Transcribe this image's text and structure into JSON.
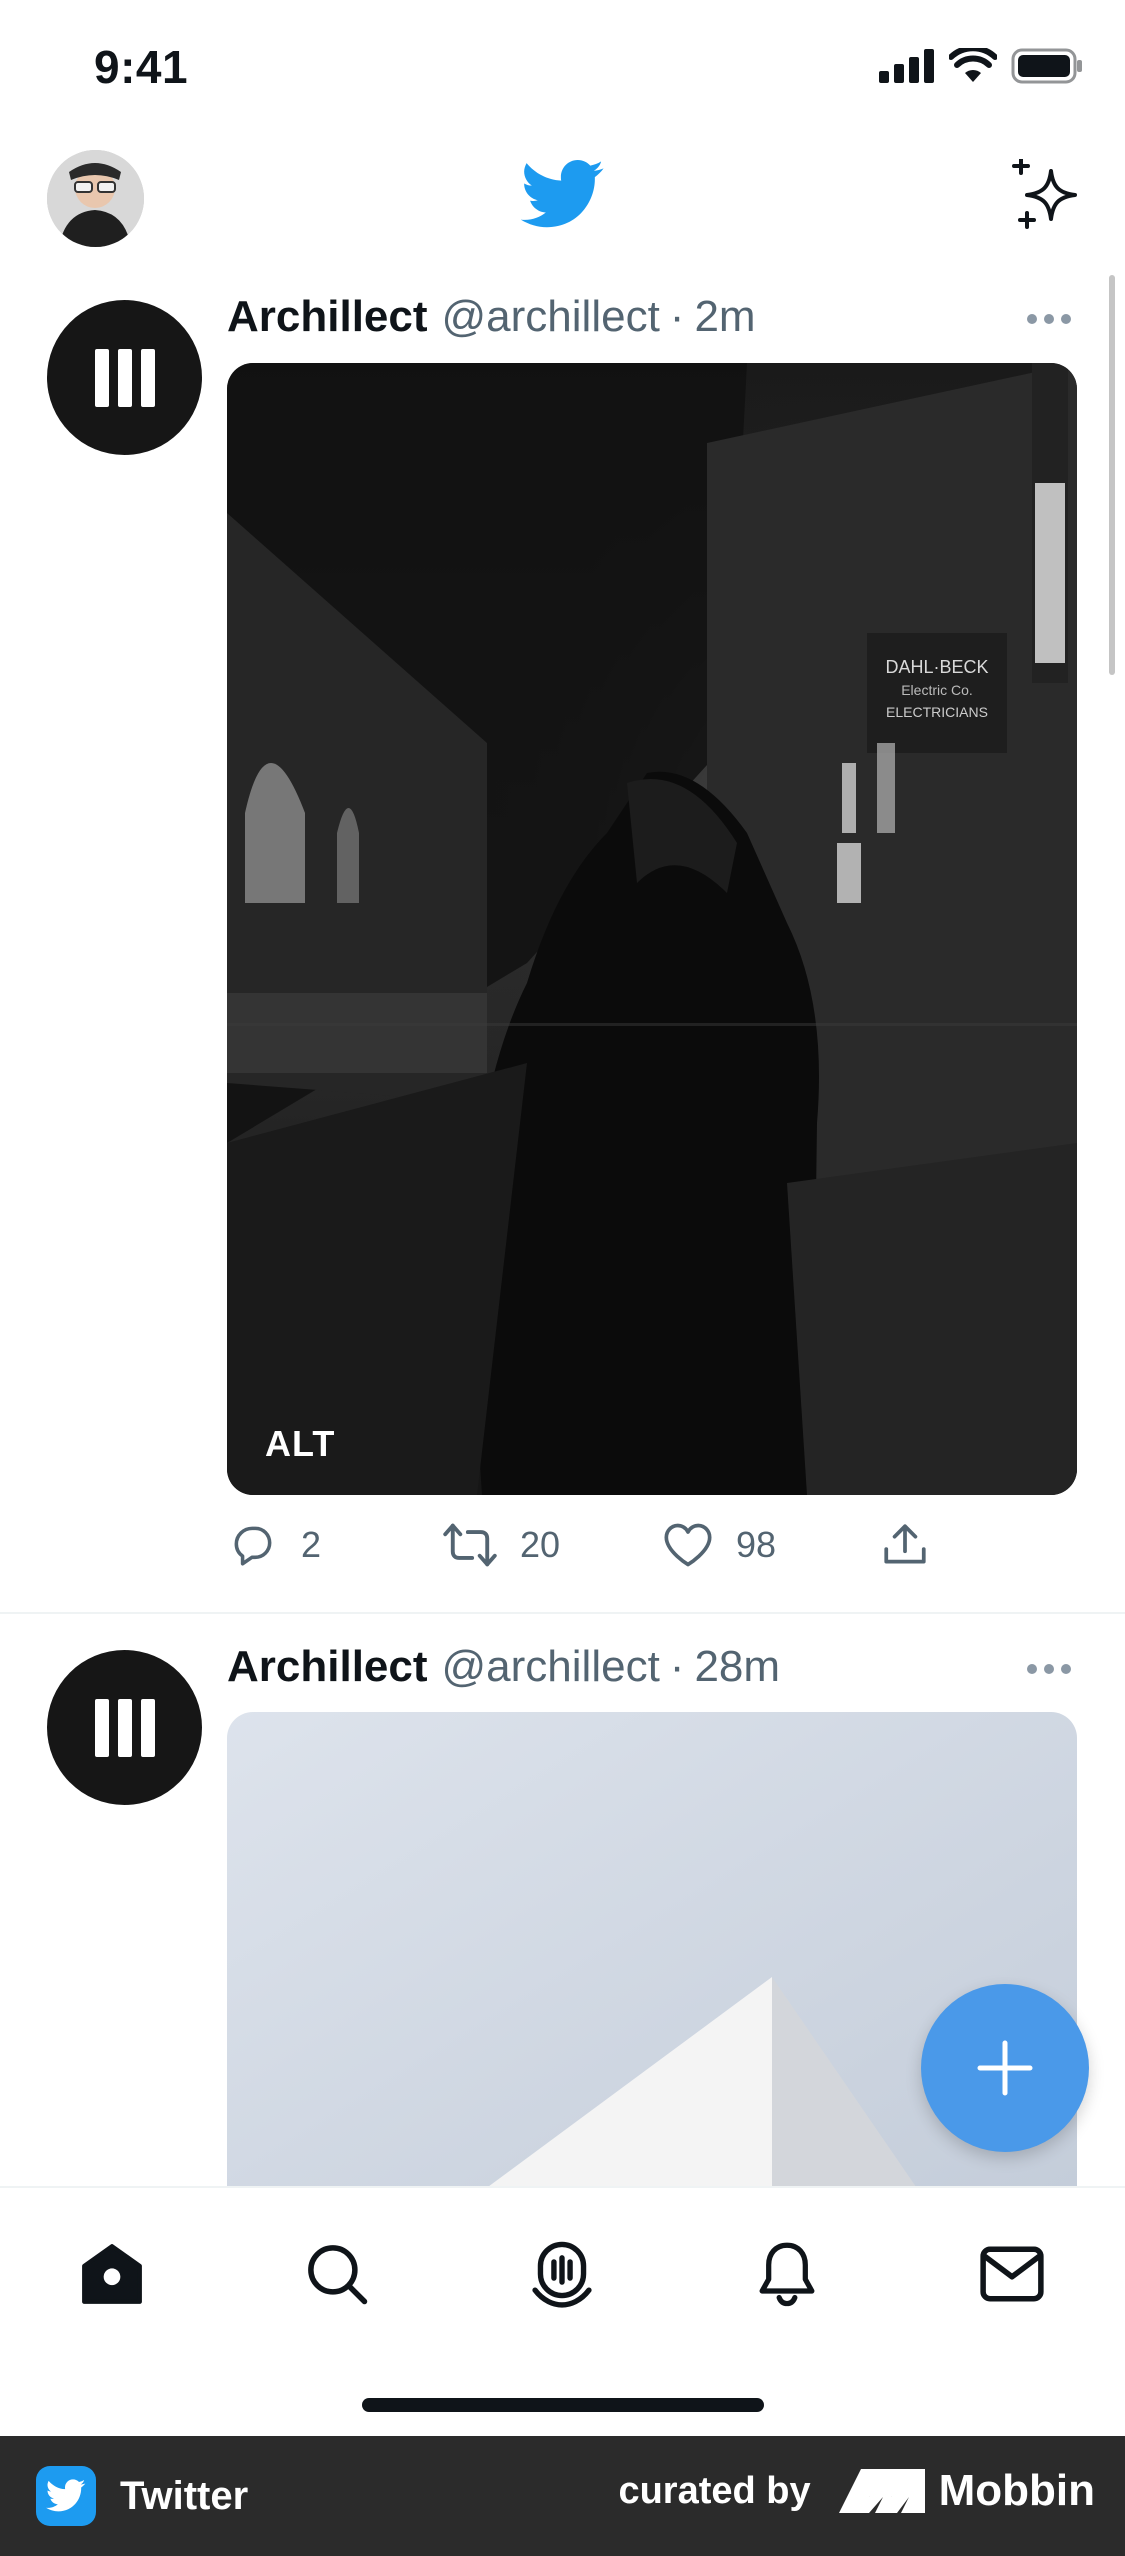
{
  "status_bar": {
    "time": "9:41"
  },
  "feed": {
    "tweets": [
      {
        "name": "Archillect",
        "handle": "@archillect",
        "separator": "·",
        "time": "2m",
        "media_alt_badge": "ALT",
        "reply_count": "2",
        "retweet_count": "20",
        "like_count": "98"
      },
      {
        "name": "Archillect",
        "handle": "@archillect",
        "separator": "·",
        "time": "28m"
      }
    ]
  },
  "footer": {
    "app_name": "Twitter",
    "curated_by": "curated by",
    "brand": "Mobbin"
  },
  "colors": {
    "twitter_blue": "#1d9bf0",
    "fab_blue": "#4a99e9",
    "text_primary": "#0f1419",
    "text_secondary": "#536471"
  },
  "icons": {
    "top_bar": [
      "avatar",
      "twitter-bird-icon",
      "sparkle-icon"
    ],
    "tweet_actions": [
      "reply-icon",
      "retweet-icon",
      "like-icon",
      "share-icon"
    ],
    "bottom_nav": [
      "home-icon",
      "search-icon",
      "spaces-icon",
      "notifications-icon",
      "messages-icon"
    ]
  }
}
